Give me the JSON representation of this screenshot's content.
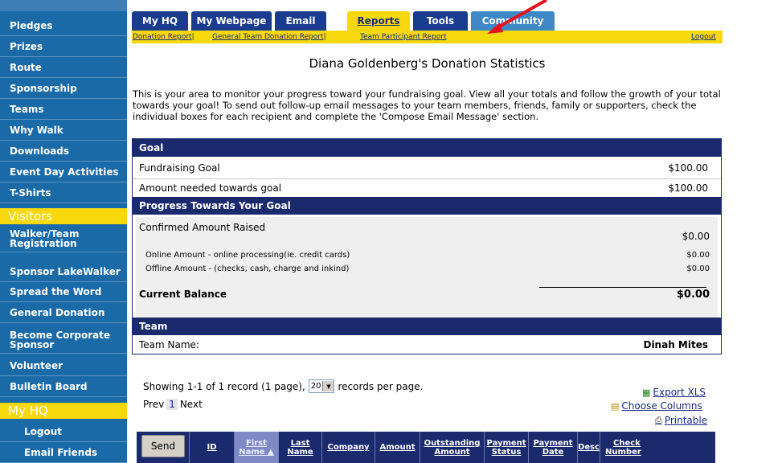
{
  "sidebar": {
    "items": [
      {
        "label": "Pledges"
      },
      {
        "label": "Prizes"
      },
      {
        "label": "Route"
      },
      {
        "label": "Sponsorship"
      },
      {
        "label": "Teams"
      },
      {
        "label": "Why Walk"
      },
      {
        "label": "Downloads"
      },
      {
        "label": "Event Day Activities"
      },
      {
        "label": "T-Shirts"
      }
    ],
    "visitors_head": "Visitors",
    "visitor_items": [
      {
        "label": "Walker/Team Registration"
      },
      {
        "label": "Sponsor LakeWalker"
      },
      {
        "label": "Spread the Word"
      },
      {
        "label": "General Donation"
      },
      {
        "label": "Become Corporate Sponsor"
      },
      {
        "label": "Volunteer"
      },
      {
        "label": "Bulletin Board"
      }
    ],
    "myhq_head": "My HQ",
    "myhq_items": [
      {
        "label": "Logout"
      },
      {
        "label": "Email Friends"
      }
    ]
  },
  "tabs": [
    "My HQ",
    "My Webpage",
    "Email",
    "Reports",
    "Tools",
    "Community"
  ],
  "subnav": {
    "links": [
      "Donation Report|",
      "General Team Donation Report|",
      "Team Participant Report"
    ],
    "logout": "Logout"
  },
  "page_title": "Diana Goldenberg's Donation Statistics",
  "intro": "This is your area to monitor your progress toward your fundraising goal. View all your totals and follow the growth of your total towards your goal! To send out follow-up email messages to your team members, friends, family or supporters, check the individual boxes for each recipient and complete the 'Compose Email Message' section.",
  "goal": {
    "header": "Goal",
    "fundraising_label": "Fundraising Goal",
    "fundraising_value": "$100.00",
    "needed_label": "Amount needed towards goal",
    "needed_value": "$100.00"
  },
  "progress": {
    "header": "Progress Towards Your Goal",
    "confirmed_label": "Confirmed Amount Raised",
    "confirmed_value": "$0.00",
    "online_label": "Online Amount - online processing(ie. credit cards)",
    "online_value": "$0.00",
    "offline_label": "Offline Amount - (checks, cash, charge and inkind)",
    "offline_value": "$0.00",
    "balance_label": "Current Balance",
    "balance_value": "$0.00"
  },
  "team": {
    "header": "Team",
    "name_label": "Team Name:",
    "name_value": "Dinah Mites"
  },
  "records": {
    "showing": "Showing 1-1 of 1 record (1 page),",
    "per_page_value": "20",
    "per_page_suffix": "records per page.",
    "prev": "Prev",
    "current_page": "1",
    "next": "Next"
  },
  "tools": {
    "export": "Export XLS",
    "choose": "Choose Columns",
    "printable": "Printable"
  },
  "grid": {
    "send": "Send",
    "columns": [
      {
        "l1": "ID",
        "l2": ""
      },
      {
        "l1": "First",
        "l2": "Name ▲"
      },
      {
        "l1": "Last",
        "l2": "Name"
      },
      {
        "l1": "Company",
        "l2": ""
      },
      {
        "l1": "Amount",
        "l2": ""
      },
      {
        "l1": "Outstanding",
        "l2": "Amount"
      },
      {
        "l1": "Payment",
        "l2": "Status"
      },
      {
        "l1": "Payment",
        "l2": "Date"
      },
      {
        "l1": "Desc",
        "l2": ""
      },
      {
        "l1": "Check",
        "l2": "Number"
      }
    ]
  }
}
